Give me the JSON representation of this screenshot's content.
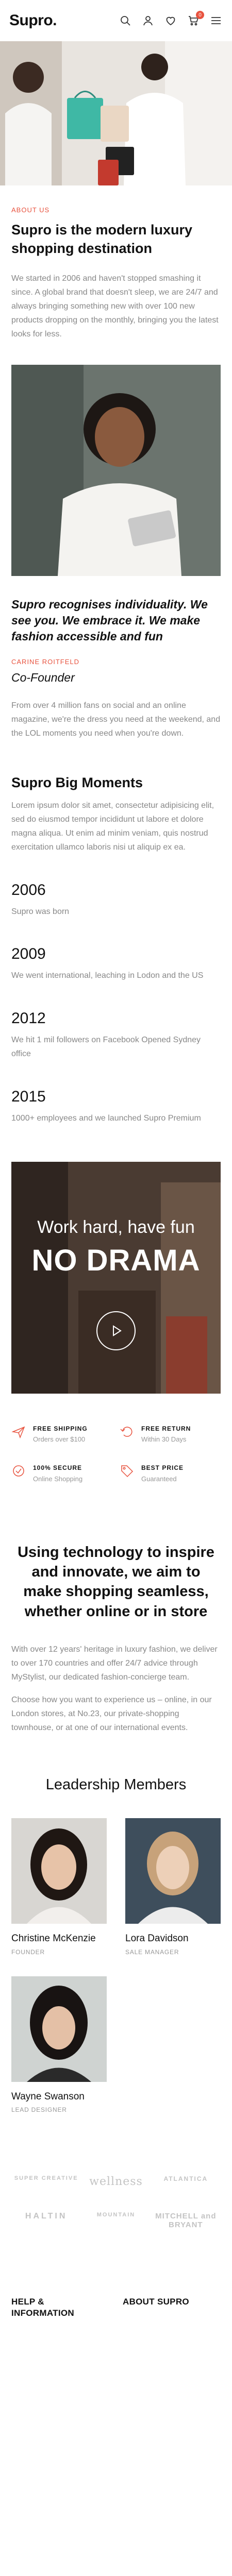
{
  "header": {
    "logo": "Supro.",
    "cart_count": "0"
  },
  "about": {
    "eyebrow": "About Us",
    "title": "Supro is the modern luxury shopping destination",
    "body": "We started in 2006 and haven't stopped smashing it since. A global brand that doesn't sleep, we are 24/7 and always bringing something new with over 100 new products dropping on the monthly, bringing you the latest looks for less."
  },
  "founder": {
    "quote": "Supro recognises individuality. We see you. We embrace it. We make fashion accessible and fun",
    "name": "Carine Roitfeld",
    "title": "Co-Founder",
    "body": "From over 4 million fans on social and an online magazine, we're the dress you need at the weekend, and the LOL moments you need when you're down."
  },
  "moments": {
    "title": "Supro Big Moments",
    "intro": "Lorem ipsum dolor sit amet, consectetur adipisicing elit, sed do eiusmod tempor incididunt ut labore et dolore magna aliqua. Ut enim ad minim veniam, quis nostrud exercitation ullamco laboris nisi ut aliquip ex ea.",
    "items": [
      {
        "year": "2006",
        "text": "Supro was born"
      },
      {
        "year": "2009",
        "text": "We went international, leaching in Lodon and the US"
      },
      {
        "year": "2012",
        "text": "We hit 1 mil followers on Facebook Opened Sydney office"
      },
      {
        "year": "2015",
        "text": "1000+ employees and we launched Supro Premium"
      }
    ]
  },
  "banner": {
    "line1": "Work hard, have fun",
    "line2": "NO DRAMA"
  },
  "features": [
    {
      "title": "FREE SHIPPING",
      "sub": "Orders over $100",
      "icon": "airplane-icon"
    },
    {
      "title": "FREE RETURN",
      "sub": "Within 30 Days",
      "icon": "return-icon"
    },
    {
      "title": "100% SECURE",
      "sub": "Online Shopping",
      "icon": "secure-icon"
    },
    {
      "title": "BEST PRICE",
      "sub": "Guaranteed",
      "icon": "price-tag-icon"
    }
  ],
  "tech": {
    "title": "Using technology to inspire and innovate, we aim to make shopping seamless, whether online or in store",
    "p1": "With over 12 years' heritage in luxury fashion, we deliver to over 170 countries and offer 24/7 advice through MyStylist, our dedicated fashion-concierge team.",
    "p2": "Choose how you want to experience us – online, in our London stores, at No.23, our private-shopping townhouse, or at one of our international events."
  },
  "leaders": {
    "title": "Leadership Members",
    "members": [
      {
        "name": "Christine McKenzie",
        "role": "Founder"
      },
      {
        "name": "Lora Davidson",
        "role": "Sale Manager"
      },
      {
        "name": "Wayne Swanson",
        "role": "Lead Designer"
      }
    ]
  },
  "brands": [
    "SUPER CREATIVE",
    "wellness",
    "ATLANTICA",
    "HALTIN",
    "MOUNTAIN",
    "MITCHELL and BRYANT"
  ],
  "footer": {
    "col1": "Help & Information",
    "col2": "About Supro"
  },
  "colors": {
    "accent": "#e8533f"
  }
}
